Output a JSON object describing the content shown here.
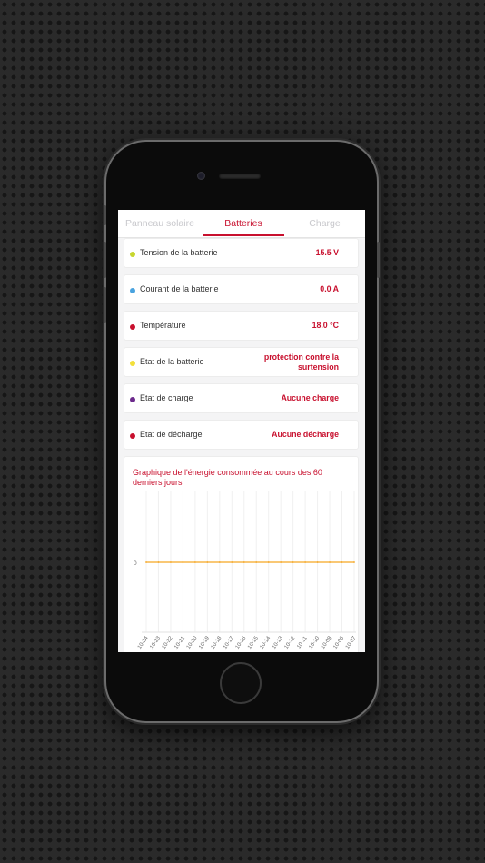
{
  "tabs": [
    {
      "label": "Panneau solaire",
      "active": false
    },
    {
      "label": "Batteries",
      "active": true
    },
    {
      "label": "Charge",
      "active": false
    }
  ],
  "rows": [
    {
      "label": "Tension de la batterie",
      "value": "15.5 V",
      "dot_color": "#c7d62f"
    },
    {
      "label": "Courant de la batterie",
      "value": "0.0 A",
      "dot_color": "#4aa3df"
    },
    {
      "label": "Température",
      "value": "18.0 °C",
      "dot_color": "#c8102e"
    },
    {
      "label": "Etat de la batterie",
      "value": "protection contre la surtension",
      "dot_color": "#f3e03b"
    },
    {
      "label": "Etat de charge",
      "value": "Aucune charge",
      "dot_color": "#6c2a8c"
    },
    {
      "label": "Etat de décharge",
      "value": "Aucune décharge",
      "dot_color": "#c8102e"
    }
  ],
  "colors": {
    "accent": "#c8102e",
    "line": "#f5a623"
  },
  "chart_data": {
    "type": "line",
    "title": "Graphique de l'énergie consommée au cours des 60 derniers jours",
    "x": [
      "10-24",
      "10-23",
      "10-22",
      "10-21",
      "10-20",
      "10-19",
      "10-18",
      "10-17",
      "10-16",
      "10-15",
      "10-14",
      "10-13",
      "10-12",
      "10-11",
      "10-10",
      "10-09",
      "10-08",
      "10-07"
    ],
    "series": [
      {
        "values": [
          0,
          0,
          0,
          0,
          0,
          0,
          0,
          0,
          0,
          0,
          0,
          0,
          0,
          0,
          0,
          0,
          0,
          0
        ]
      }
    ],
    "ytick_labels": [
      "0"
    ],
    "grid": true
  }
}
